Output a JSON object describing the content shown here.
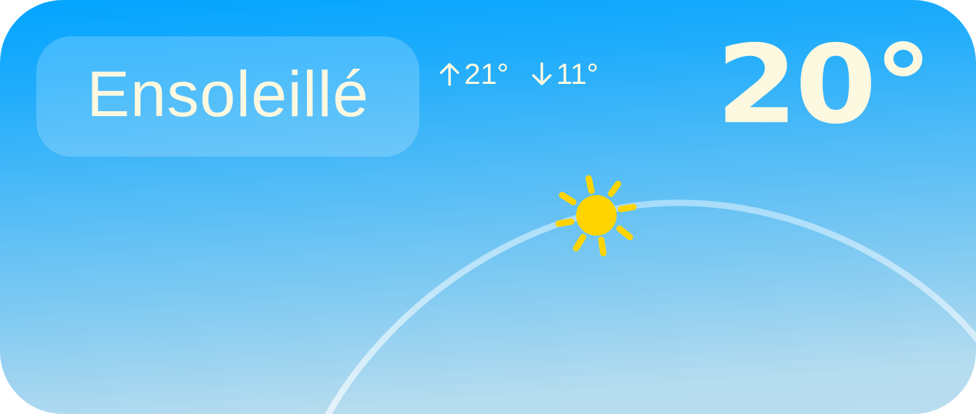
{
  "widget": {
    "condition": "Ensoleillé",
    "high": "21°",
    "low": "11°",
    "temperature": "20°",
    "icons": {
      "high": "arrow-up-icon",
      "low": "arrow-down-icon",
      "sun": "sun-icon"
    },
    "colors": {
      "sky_top": "#02a4ff",
      "sky_bottom": "#b8ddef",
      "text": "#fdf8e0",
      "sun": "#ffd400"
    }
  }
}
